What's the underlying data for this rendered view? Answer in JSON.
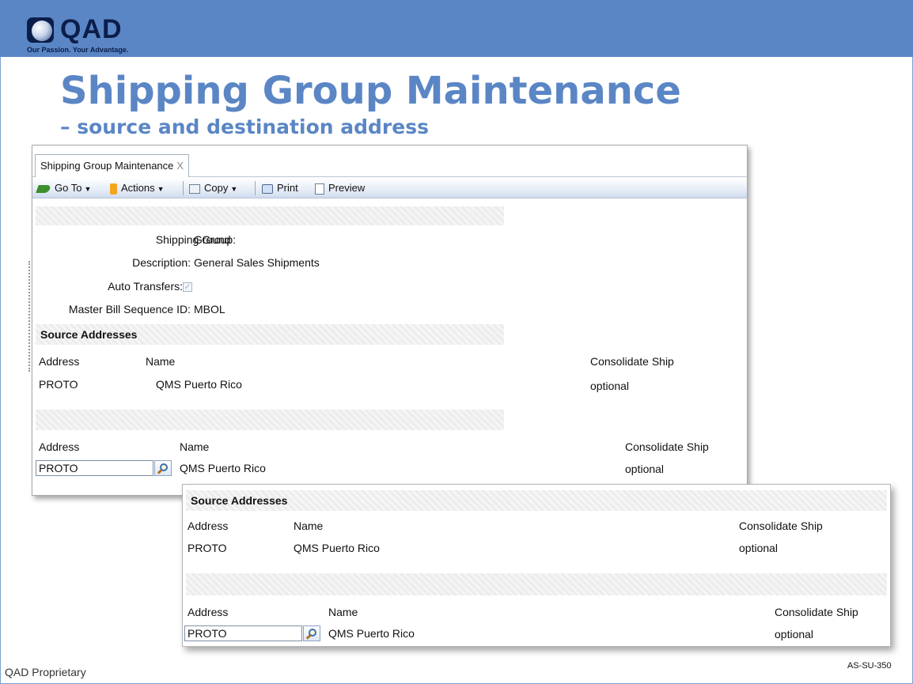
{
  "slide": {
    "logo_text": "QAD",
    "tagline": "Our Passion. Your Advantage.",
    "title": "Shipping Group Maintenance",
    "subtitle": "– source and destination address",
    "footer_left": "QAD Proprietary",
    "footer_right": "AS-SU-350",
    "header_color": "#5b86c5"
  },
  "window": {
    "tab_label": "Shipping Group Maintenance",
    "tab_close": "X",
    "toolbar": {
      "goto": "Go To",
      "actions": "Actions",
      "copy": "Copy",
      "print": "Print",
      "preview": "Preview"
    },
    "form": {
      "shipping_group_label": "Shipping Group:",
      "shipping_group_value": "Ground",
      "description_label": "Description:",
      "description_value": "General Sales Shipments",
      "auto_transfers_label": "Auto Transfers:",
      "auto_transfers_checked": true,
      "master_bill_label": "Master Bill Sequence ID:",
      "master_bill_value": "MBOL"
    },
    "source_section": {
      "title": "Source Addresses",
      "headers": {
        "address": "Address",
        "name": "Name",
        "consolidate": "Consolidate Ship"
      },
      "row": {
        "address": "PROTO",
        "name": "QMS Puerto Rico",
        "consolidate": "optional"
      }
    },
    "edit_row": {
      "headers": {
        "address": "Address",
        "name": "Name",
        "consolidate": "Consolidate Ship"
      },
      "address_value": "PROTO",
      "name": "QMS Puerto Rico",
      "consolidate": "optional"
    }
  },
  "zoom": {
    "title": "Source Addresses",
    "headers": {
      "address": "Address",
      "name": "Name",
      "consolidate": "Consolidate Ship"
    },
    "row": {
      "address": "PROTO",
      "name": "QMS Puerto Rico",
      "consolidate": "optional"
    },
    "edit_headers": {
      "address": "Address",
      "name": "Name",
      "consolidate": "Consolidate Ship"
    },
    "edit_address_value": "PROTO",
    "edit_name": "QMS Puerto Rico",
    "edit_consolidate": "optional"
  }
}
